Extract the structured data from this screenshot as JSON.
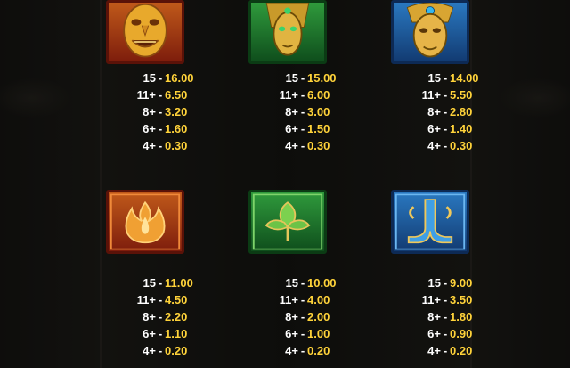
{
  "colors": {
    "count_text": "#ffffff",
    "payout_text": "#ffd33a",
    "background": "#1b1a16"
  },
  "symbols": [
    {
      "icon": "golden-tribal-mask-icon",
      "color": "red",
      "pays": [
        {
          "count": "15",
          "value": "16.00"
        },
        {
          "count": "11+",
          "value": "6.50"
        },
        {
          "count": "8+",
          "value": "3.20"
        },
        {
          "count": "6+",
          "value": "1.60"
        },
        {
          "count": "4+",
          "value": "0.30"
        }
      ]
    },
    {
      "icon": "golden-headdress-mask-icon",
      "color": "green",
      "pays": [
        {
          "count": "15",
          "value": "15.00"
        },
        {
          "count": "11+",
          "value": "6.00"
        },
        {
          "count": "8+",
          "value": "3.00"
        },
        {
          "count": "6+",
          "value": "1.50"
        },
        {
          "count": "4+",
          "value": "0.30"
        }
      ]
    },
    {
      "icon": "golden-jewel-mask-icon",
      "color": "blue",
      "pays": [
        {
          "count": "15",
          "value": "14.00"
        },
        {
          "count": "11+",
          "value": "5.50"
        },
        {
          "count": "8+",
          "value": "2.80"
        },
        {
          "count": "6+",
          "value": "1.40"
        },
        {
          "count": "4+",
          "value": "0.30"
        }
      ]
    },
    {
      "icon": "fire-glyph-icon",
      "color": "red",
      "pays": [
        {
          "count": "15",
          "value": "11.00"
        },
        {
          "count": "11+",
          "value": "4.50"
        },
        {
          "count": "8+",
          "value": "2.20"
        },
        {
          "count": "6+",
          "value": "1.10"
        },
        {
          "count": "4+",
          "value": "0.20"
        }
      ]
    },
    {
      "icon": "leaf-glyph-icon",
      "color": "green",
      "pays": [
        {
          "count": "15",
          "value": "10.00"
        },
        {
          "count": "11+",
          "value": "4.00"
        },
        {
          "count": "8+",
          "value": "2.00"
        },
        {
          "count": "6+",
          "value": "1.00"
        },
        {
          "count": "4+",
          "value": "0.20"
        }
      ]
    },
    {
      "icon": "water-glyph-icon",
      "color": "blue",
      "pays": [
        {
          "count": "15",
          "value": "9.00"
        },
        {
          "count": "11+",
          "value": "3.50"
        },
        {
          "count": "8+",
          "value": "1.80"
        },
        {
          "count": "6+",
          "value": "0.90"
        },
        {
          "count": "4+",
          "value": "0.20"
        }
      ]
    }
  ]
}
